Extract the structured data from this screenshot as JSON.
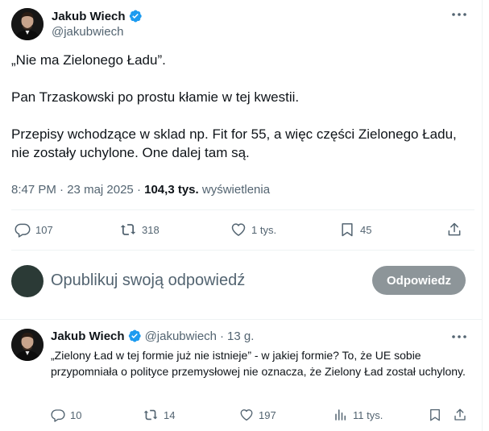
{
  "main_tweet": {
    "author_name": "Jakub Wiech",
    "author_handle": "@jakubwiech",
    "verified": true,
    "paragraphs": [
      "„Nie ma Zielonego Ładu”.",
      "Pan Trzaskowski po prostu kłamie w tej kwestii.",
      "Przepisy wchodzące w sklad np. Fit for 55, a więc części Zielonego Ładu, nie zostały uchylone. One dalej tam są."
    ],
    "time": "8:47 PM",
    "separator": "·",
    "date": "23 maj 2025",
    "views_count": "104,3 tys.",
    "views_label": "wyświetlenia",
    "actions": {
      "replies": "107",
      "reposts": "318",
      "likes": "1 tys.",
      "bookmarks": "45"
    }
  },
  "composer": {
    "placeholder": "Opublikuj swoją odpowiedź",
    "button_label": "Odpowiedz"
  },
  "reply_tweet": {
    "author_name": "Jakub Wiech",
    "author_handle": "@jakubwiech",
    "separator": "·",
    "time_ago": "13 g.",
    "verified": true,
    "text": "„Zielony Ład w tej formie już nie istnieje” - w jakiej formie? To, że UE sobie przypomniała o polityce przemysłowej nie oznacza, że Zielony Ład został uchylony.",
    "actions": {
      "replies": "10",
      "reposts": "14",
      "likes": "197",
      "views": "11 tys."
    }
  },
  "colors": {
    "text_primary": "#0f1419",
    "text_secondary": "#536471",
    "verified_blue": "#1d9bf0",
    "divider": "#eff3f4",
    "button_disabled": "#8d9599"
  },
  "icons": {
    "verified": "verified-badge-icon",
    "more": "more-options-icon",
    "reply": "reply-icon",
    "repost": "repost-icon",
    "like": "heart-icon",
    "bookmark": "bookmark-icon",
    "share": "share-icon",
    "views": "views-bar-chart-icon"
  }
}
